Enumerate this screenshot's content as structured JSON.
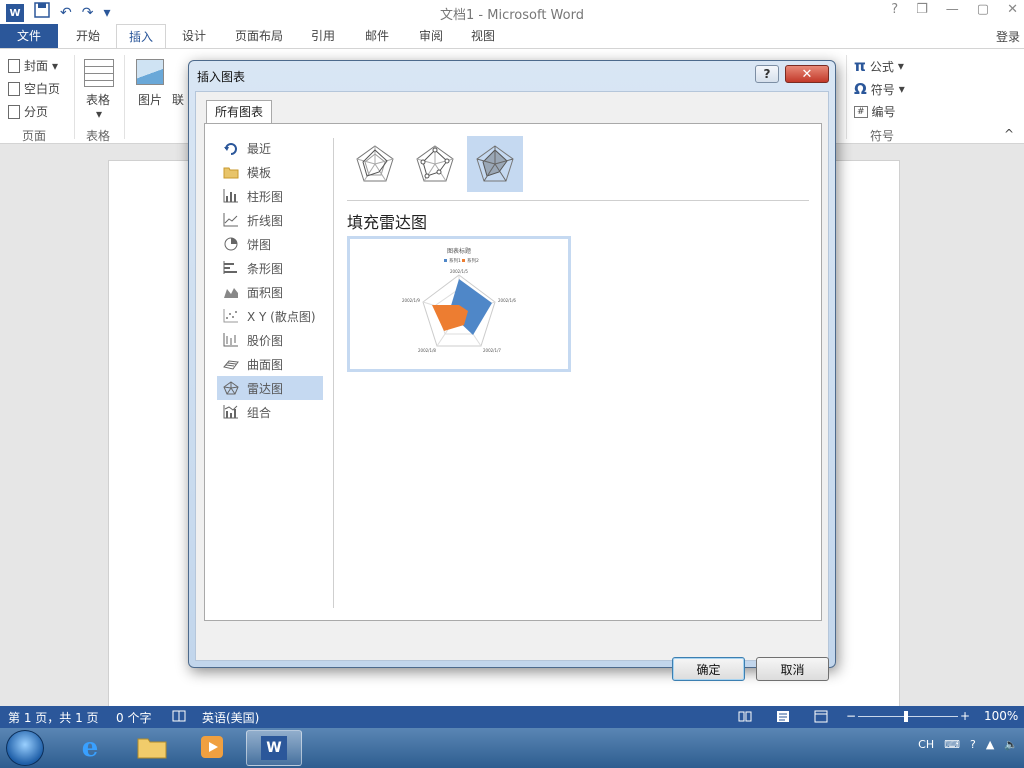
{
  "app": {
    "title": "文档1 - Microsoft Word"
  },
  "titlebar": {
    "qat_undo": "↶",
    "qat_redo": "↷",
    "winctl": {
      "help": "?",
      "restore": "❐",
      "minimize": "—",
      "maximize": "▢",
      "close": "✕"
    }
  },
  "ribbon_tabs": [
    "文件",
    "开始",
    "插入",
    "设计",
    "页面布局",
    "引用",
    "邮件",
    "审阅",
    "视图"
  ],
  "ribbon_active_tab": "插入",
  "login": "登录",
  "ribbon": {
    "pages_group": {
      "cover": "封面",
      "blank": "空白页",
      "break": "分页",
      "label": "页面"
    },
    "tables_group": {
      "table": "表格",
      "label": "表格"
    },
    "illustrations": {
      "picture": "图片",
      "online": "联"
    },
    "symbols_group": {
      "equation": "公式",
      "symbol": "符号",
      "number": "编号",
      "label": "符号"
    }
  },
  "dialog": {
    "title": "插入图表",
    "tab_all": "所有图表",
    "categories": [
      {
        "label": "最近",
        "icon": "recent-icon"
      },
      {
        "label": "模板",
        "icon": "folder-icon"
      },
      {
        "label": "柱形图",
        "icon": "column-chart-icon"
      },
      {
        "label": "折线图",
        "icon": "line-chart-icon"
      },
      {
        "label": "饼图",
        "icon": "pie-chart-icon"
      },
      {
        "label": "条形图",
        "icon": "bar-chart-icon"
      },
      {
        "label": "面积图",
        "icon": "area-chart-icon"
      },
      {
        "label": "X Y (散点图)",
        "icon": "scatter-chart-icon"
      },
      {
        "label": "股价图",
        "icon": "stock-chart-icon"
      },
      {
        "label": "曲面图",
        "icon": "surface-chart-icon"
      },
      {
        "label": "雷达图",
        "icon": "radar-chart-icon"
      },
      {
        "label": "组合",
        "icon": "combo-chart-icon"
      }
    ],
    "selected_category": "雷达图",
    "subtypes": [
      "radar-icon",
      "radar-markers-icon",
      "filled-radar-icon"
    ],
    "selected_subtype": "filled-radar-icon",
    "selected_title": "填充雷达图",
    "ok": "确定",
    "cancel": "取消"
  },
  "preview_chart": {
    "title": "图表标题",
    "legend": [
      "系列1",
      "系列2"
    ],
    "axis_labels": [
      "2002/1/5",
      "2002/1/6",
      "2002/1/7",
      "2002/1/8",
      "2002/1/9"
    ],
    "colors": {
      "series1": "#4f87c8",
      "series2": "#ed7d31"
    }
  },
  "statusbar": {
    "page": "第 1 页，共 1 页",
    "words": "0 个字",
    "language": "英语(美国)",
    "zoom": "100%",
    "zoom_minus": "−",
    "zoom_plus": "+"
  },
  "taskbar": {
    "lang": "CH"
  },
  "colors": {
    "accent": "#2b579a",
    "selection": "#c5d9f1"
  }
}
